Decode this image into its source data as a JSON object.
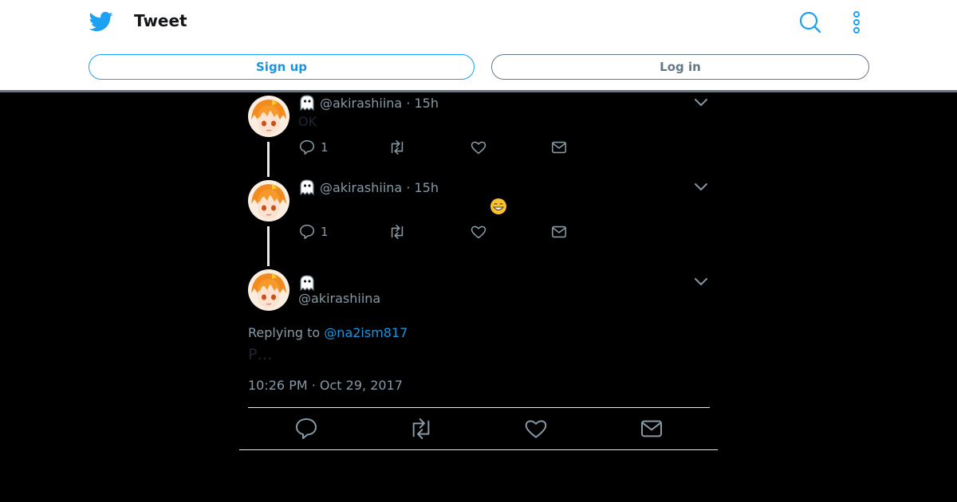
{
  "header": {
    "title": "Tweet",
    "signup_label": "Sign up",
    "login_label": "Log in",
    "brand_color": "#1da1f2"
  },
  "thread": [
    {
      "handle": "@akirashiina",
      "time": "15h",
      "text": "OK",
      "reply_count": "1"
    },
    {
      "handle": "@akirashiina",
      "time": "15h",
      "text": "",
      "emoji": "grinning-face-emoji",
      "reply_count": "1"
    }
  ],
  "main_tweet": {
    "handle": "@akirashiina",
    "replying_prefix": "Replying to",
    "replying_to": "@na2ism817",
    "text": "P…",
    "timestamp": "10:26 PM · Oct 29, 2017"
  },
  "icons": {
    "logo": "twitter-bird-icon",
    "search": "search-icon",
    "more": "more-vertical-icon",
    "reply": "reply-icon",
    "retweet": "retweet-icon",
    "like": "heart-icon",
    "dm": "mail-icon",
    "caret": "chevron-down-icon",
    "name": "ghost-emoji-icon"
  }
}
